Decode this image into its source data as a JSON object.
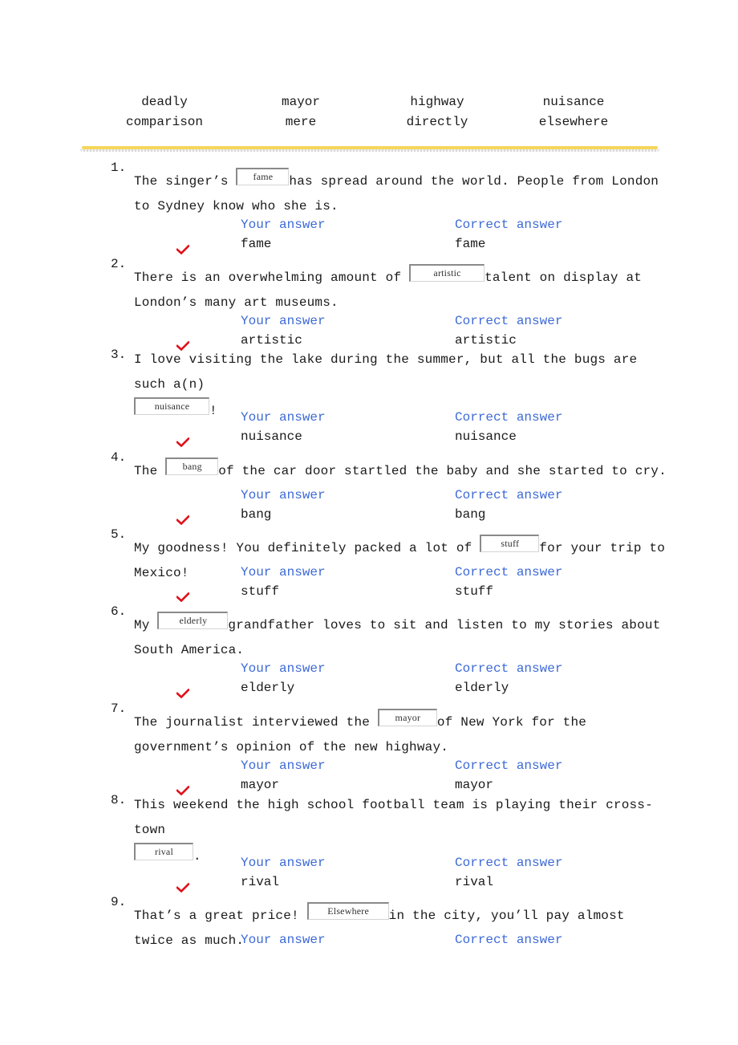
{
  "word_bank": {
    "rows": [
      [
        "deadly",
        "mayor",
        "highway",
        "nuisance"
      ],
      [
        "comparison",
        "mere",
        "directly",
        "elsewhere"
      ]
    ]
  },
  "labels": {
    "your_answer": "Your answer",
    "correct_answer": "Correct answer"
  },
  "colors": {
    "label_blue": "#3d6ad6",
    "check_red": "#e0101a",
    "divider_gold": "#f6d65a"
  },
  "questions": [
    {
      "number": "1.",
      "before": "The singer’s ",
      "blank": "fame",
      "after": "has spread around the world. People from London to Sydney know who she is.",
      "your_answer": "fame",
      "correct_answer": "fame",
      "status": "correct"
    },
    {
      "number": "2.",
      "before": "There is an overwhelming amount of ",
      "blank": "artistic",
      "after": "talent on display at London’s many art museums.",
      "your_answer": "artistic",
      "correct_answer": "artistic",
      "status": "correct"
    },
    {
      "number": "3.",
      "before": "I love visiting the lake during the summer, but all the bugs are such a(n) ",
      "blank": "nuisance",
      "after": "!",
      "your_answer": "nuisance",
      "correct_answer": "nuisance",
      "status": "correct"
    },
    {
      "number": "4.",
      "before": "The ",
      "blank": "bang",
      "after": "of the car door startled the baby and she started to cry.",
      "your_answer": "bang",
      "correct_answer": "bang",
      "status": "correct"
    },
    {
      "number": "5.",
      "before": "My goodness! You definitely packed a lot of ",
      "blank": "stuff",
      "after": "for your trip to Mexico!",
      "your_answer": "stuff",
      "correct_answer": "stuff",
      "status": "correct"
    },
    {
      "number": "6.",
      "before": "My ",
      "blank": "elderly",
      "after": "grandfather loves to sit and listen to my stories about South America.",
      "your_answer": "elderly",
      "correct_answer": "elderly",
      "status": "correct"
    },
    {
      "number": "7.",
      "before": "The journalist interviewed the ",
      "blank": "mayor",
      "after": "of New York for the government’s opinion of the new highway.",
      "your_answer": "mayor",
      "correct_answer": "mayor",
      "status": "correct"
    },
    {
      "number": "8.",
      "before": "This weekend the high school football team is playing their cross-town ",
      "blank": "rival",
      "after": ".",
      "your_answer": "rival",
      "correct_answer": "rival",
      "status": "correct"
    },
    {
      "number": "9.",
      "before": "That’s a great price! ",
      "blank": "Elsewhere",
      "after": "in the city, you’ll pay almost twice as much.",
      "your_answer": "",
      "correct_answer": "",
      "status": ""
    }
  ]
}
